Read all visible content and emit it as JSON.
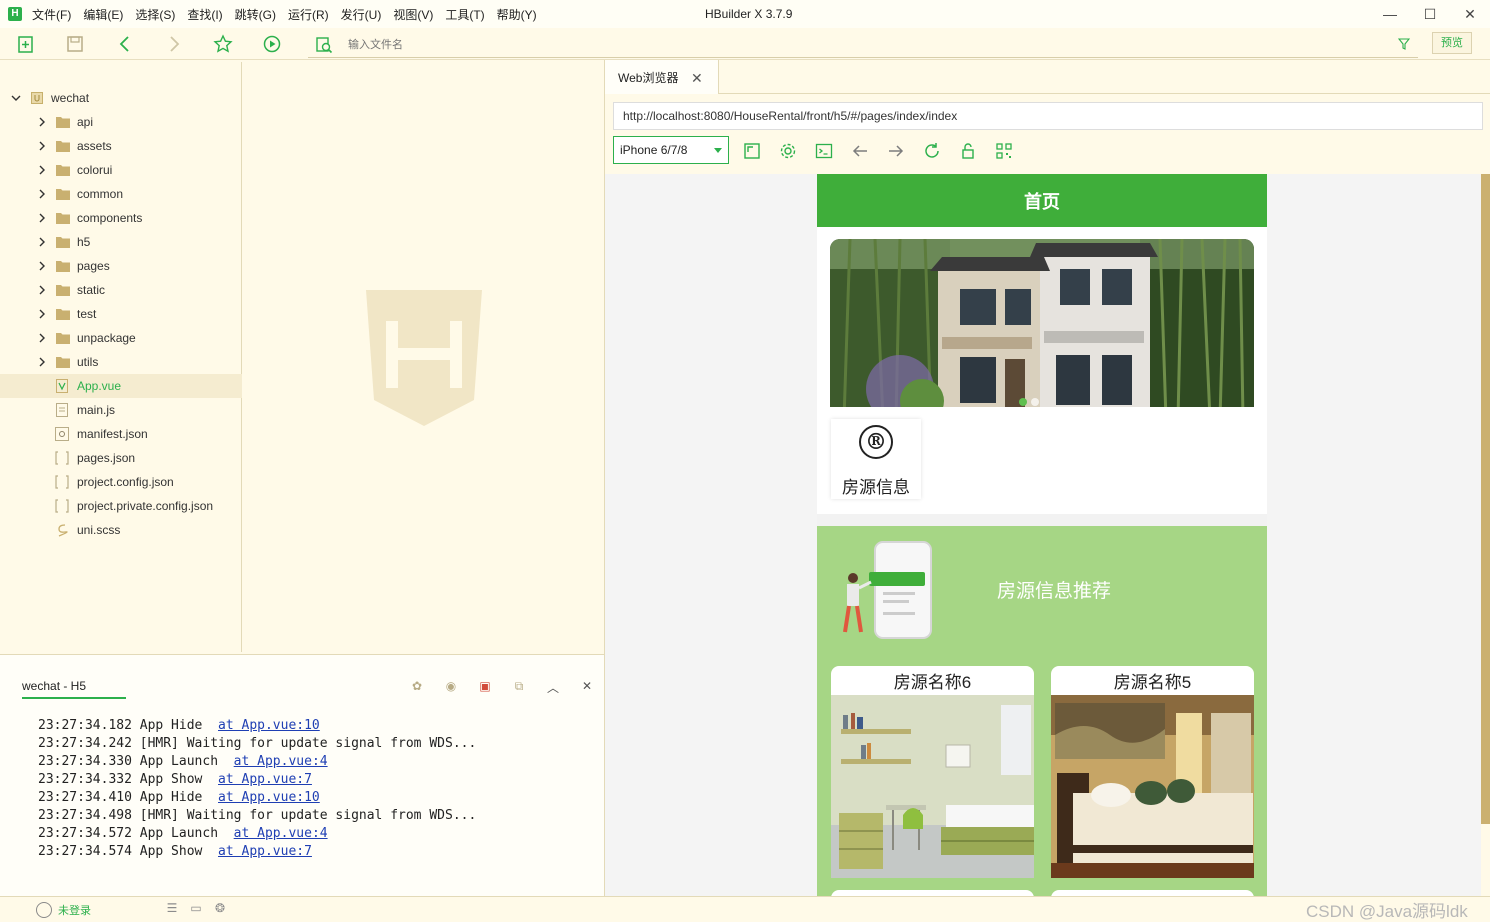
{
  "titlebar": {
    "app_title": "HBuilder X 3.7.9",
    "logo_letter": "H",
    "menu": [
      "文件(F)",
      "编辑(E)",
      "选择(S)",
      "查找(I)",
      "跳转(G)",
      "运行(R)",
      "发行(U)",
      "视图(V)",
      "工具(T)",
      "帮助(Y)"
    ],
    "window_controls": [
      "—",
      "☐",
      "✕"
    ]
  },
  "toolbar": {
    "file_search_placeholder": "输入文件名",
    "preview_label": "预览"
  },
  "project_tree": {
    "root": "wechat",
    "items": [
      {
        "label": "api",
        "kind": "folder"
      },
      {
        "label": "assets",
        "kind": "folder"
      },
      {
        "label": "colorui",
        "kind": "folder"
      },
      {
        "label": "common",
        "kind": "folder"
      },
      {
        "label": "components",
        "kind": "folder"
      },
      {
        "label": "h5",
        "kind": "folder"
      },
      {
        "label": "pages",
        "kind": "folder"
      },
      {
        "label": "static",
        "kind": "folder"
      },
      {
        "label": "test",
        "kind": "folder"
      },
      {
        "label": "unpackage",
        "kind": "folder"
      },
      {
        "label": "utils",
        "kind": "folder"
      },
      {
        "label": "App.vue",
        "kind": "vue",
        "active": true
      },
      {
        "label": "main.js",
        "kind": "file"
      },
      {
        "label": "manifest.json",
        "kind": "json-manifest"
      },
      {
        "label": "pages.json",
        "kind": "json"
      },
      {
        "label": "project.config.json",
        "kind": "json"
      },
      {
        "label": "project.private.config.json",
        "kind": "json"
      },
      {
        "label": "uni.scss",
        "kind": "scss"
      }
    ]
  },
  "console": {
    "tab_label": "wechat - H5",
    "lines": [
      {
        "time": "23:27:34.182",
        "text": " App Hide  ",
        "link": "at App.vue:10"
      },
      {
        "time": "23:27:34.242",
        "text": " [HMR] Waiting for update signal from WDS...",
        "link": ""
      },
      {
        "time": "23:27:34.330",
        "text": " App Launch  ",
        "link": "at App.vue:4"
      },
      {
        "time": "23:27:34.332",
        "text": " App Show  ",
        "link": "at App.vue:7"
      },
      {
        "time": "23:27:34.410",
        "text": " App Hide  ",
        "link": "at App.vue:10"
      },
      {
        "time": "23:27:34.498",
        "text": " [HMR] Waiting for update signal from WDS...",
        "link": ""
      },
      {
        "time": "23:27:34.572",
        "text": " App Launch  ",
        "link": "at App.vue:4"
      },
      {
        "time": "23:27:34.574",
        "text": " App Show  ",
        "link": "at App.vue:7"
      }
    ]
  },
  "statusbar": {
    "login_label": "未登录",
    "watermark": "CSDN @Java源码ldk"
  },
  "browser": {
    "tab_label": "Web浏览器",
    "url": "http://localhost:8080/HouseRental/front/h5/#/pages/index/index",
    "device": "iPhone 6/7/8"
  },
  "phone": {
    "header_title": "首页",
    "category_label": "房源信息",
    "category_icon": "®",
    "recommend_title": "房源信息推荐",
    "houses": [
      {
        "name": "房源名称6"
      },
      {
        "name": "房源名称5"
      }
    ]
  },
  "colors": {
    "accent": "#2cb04c",
    "phone_header": "#3fae3a",
    "recommend_bg": "#a6d685",
    "ide_bg": "#fffae8"
  }
}
